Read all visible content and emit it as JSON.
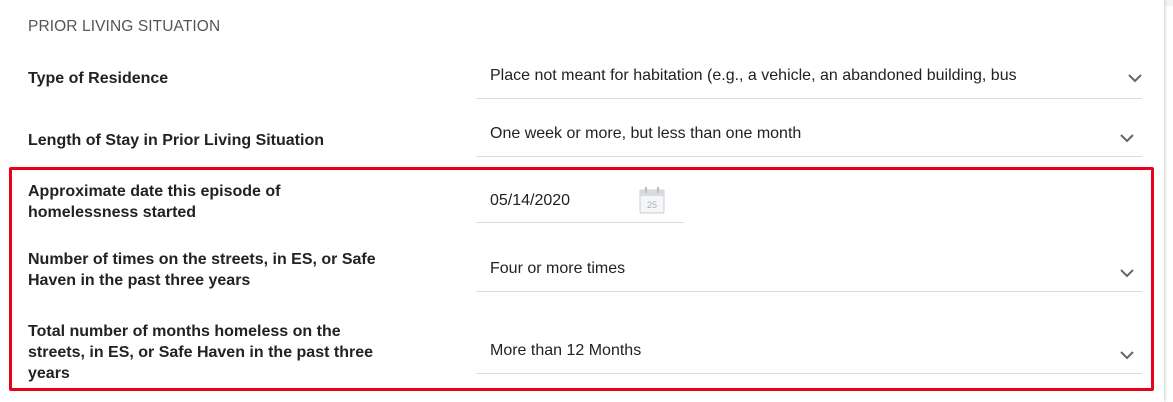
{
  "section": {
    "title": "PRIOR LIVING SITUATION"
  },
  "fields": {
    "residence": {
      "label": "Type of Residence",
      "value": "Place not meant for habitation (e.g., a vehicle, an abandoned building, bus"
    },
    "length_of_stay": {
      "label": "Length of Stay in Prior Living Situation",
      "value": "One week or more, but less than one month"
    },
    "episode_date": {
      "label_line1": "Approximate date this episode of",
      "label_line2": "homelessness started",
      "value": "05/14/2020",
      "calendar_day": "25"
    },
    "times_on_streets": {
      "label_line1": "Number of times on the streets, in ES, or Safe",
      "label_line2": "Haven in the past three years",
      "value": "Four or more times"
    },
    "months_homeless": {
      "label_line1": "Total number of months homeless on the",
      "label_line2": "streets, in ES, or Safe Haven in the past three",
      "label_line3": "years",
      "value": "More than 12 Months"
    }
  },
  "colors": {
    "highlight": "#e8001c",
    "divider": "#dcdcdc"
  }
}
